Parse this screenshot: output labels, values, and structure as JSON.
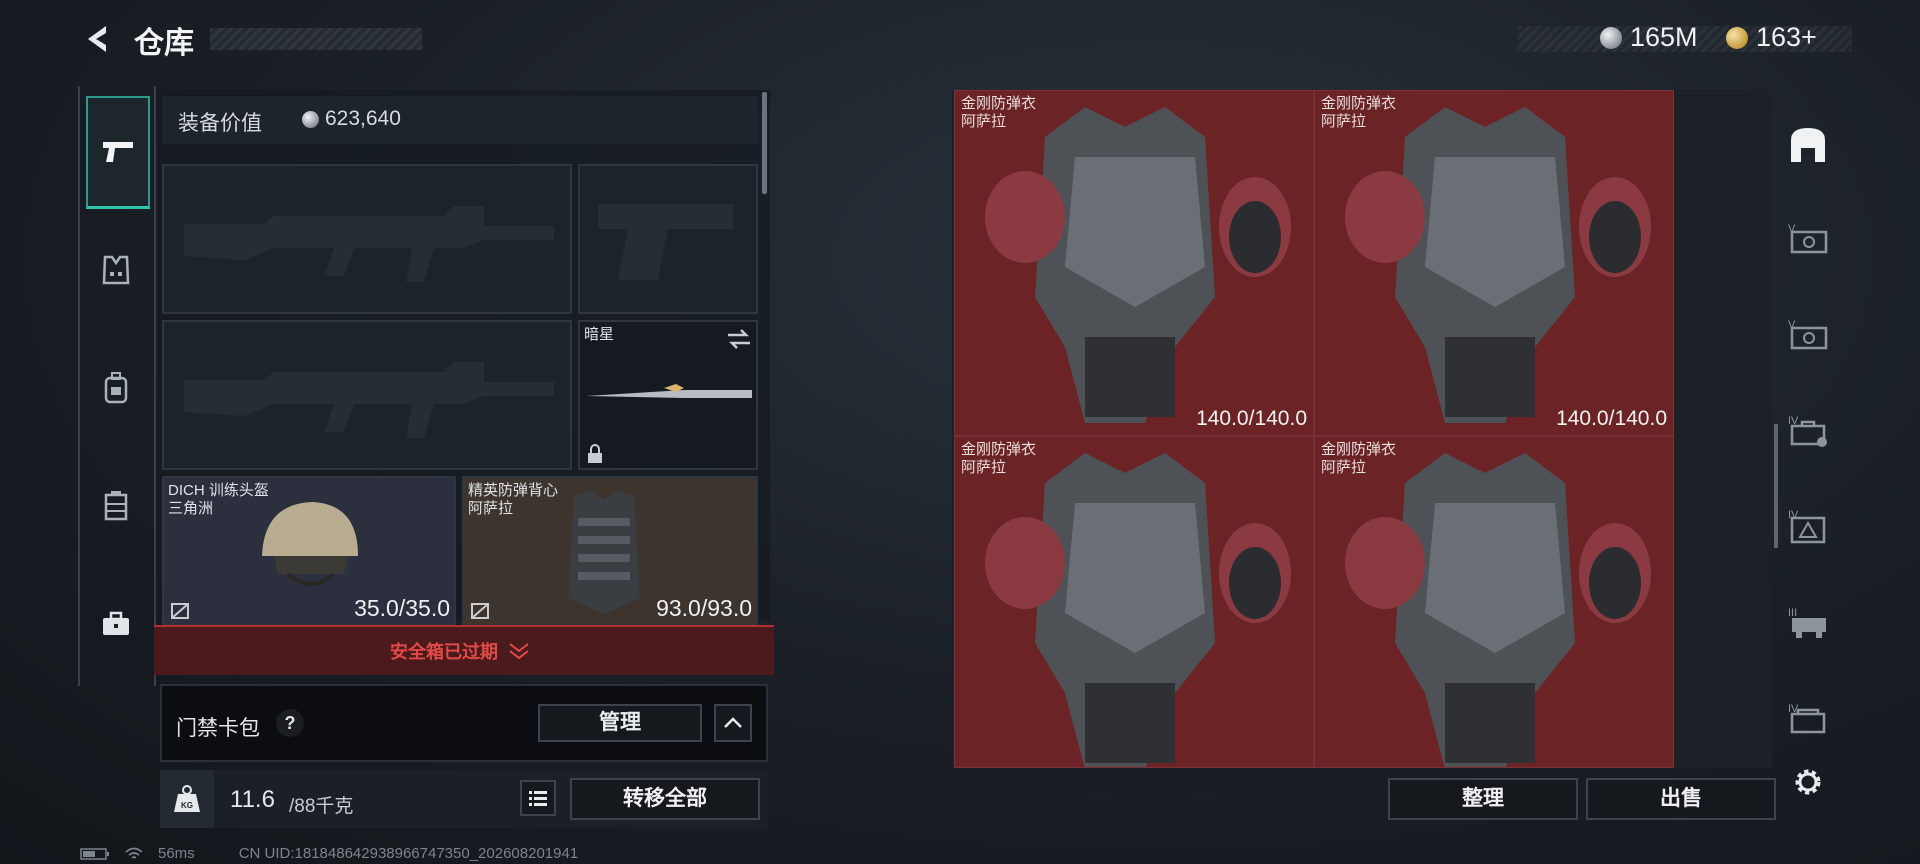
{
  "header": {
    "title": "仓库",
    "currencies": [
      {
        "icon": "silver-coin-icon",
        "value": "165M"
      },
      {
        "icon": "gold-coin-icon",
        "value": "163+"
      }
    ]
  },
  "left_rail": {
    "items": [
      {
        "name": "weapons",
        "icon": "pistol-icon",
        "active": true
      },
      {
        "name": "armor",
        "icon": "vest-icon"
      },
      {
        "name": "backpack",
        "icon": "backpack-icon"
      },
      {
        "name": "chest-rig",
        "icon": "chest-rig-icon"
      },
      {
        "name": "case",
        "icon": "briefcase-icon"
      }
    ]
  },
  "equipment": {
    "value_label": "装备价值",
    "value": "623,640",
    "melee": {
      "label": "暗星"
    },
    "helmet": {
      "name": "DICH 训练头盔",
      "origin": "三角洲",
      "durability": "35.0/35.0"
    },
    "vest": {
      "name": "精英防弹背心",
      "origin": "阿萨拉",
      "durability": "93.0/93.0"
    }
  },
  "safe_box": {
    "text": "安全箱已过期"
  },
  "card_pack": {
    "label": "门禁卡包",
    "help": "?",
    "manage": "管理"
  },
  "weight": {
    "current": "11.6",
    "capacity": "/88千克",
    "transfer_all": "转移全部",
    "unit_icon": "KG"
  },
  "storage": {
    "items": [
      {
        "name": "金刚防弹衣",
        "origin": "阿萨拉",
        "durability": "140.0/140.0"
      },
      {
        "name": "金刚防弹衣",
        "origin": "阿萨拉",
        "durability": "140.0/140.0"
      },
      {
        "name": "金刚防弹衣",
        "origin": "阿萨拉",
        "durability": ""
      },
      {
        "name": "金刚防弹衣",
        "origin": "阿萨拉",
        "durability": ""
      }
    ],
    "sort": "整理",
    "sell": "出售"
  },
  "right_rail": {
    "items": [
      "home-storage-icon",
      "case-v-icon",
      "case-v2-icon",
      "case-iv-icon",
      "case-iv-warning-icon",
      "case-iii-icon",
      "case-iv2-icon",
      "settings-icon"
    ]
  },
  "footer": {
    "ping": "56ms",
    "uid": "CN UID:1818486429389667473​50_202608201941"
  },
  "colors": {
    "accent": "#30c4ac",
    "danger": "#e44a45",
    "cell_red": "#6b2326"
  }
}
